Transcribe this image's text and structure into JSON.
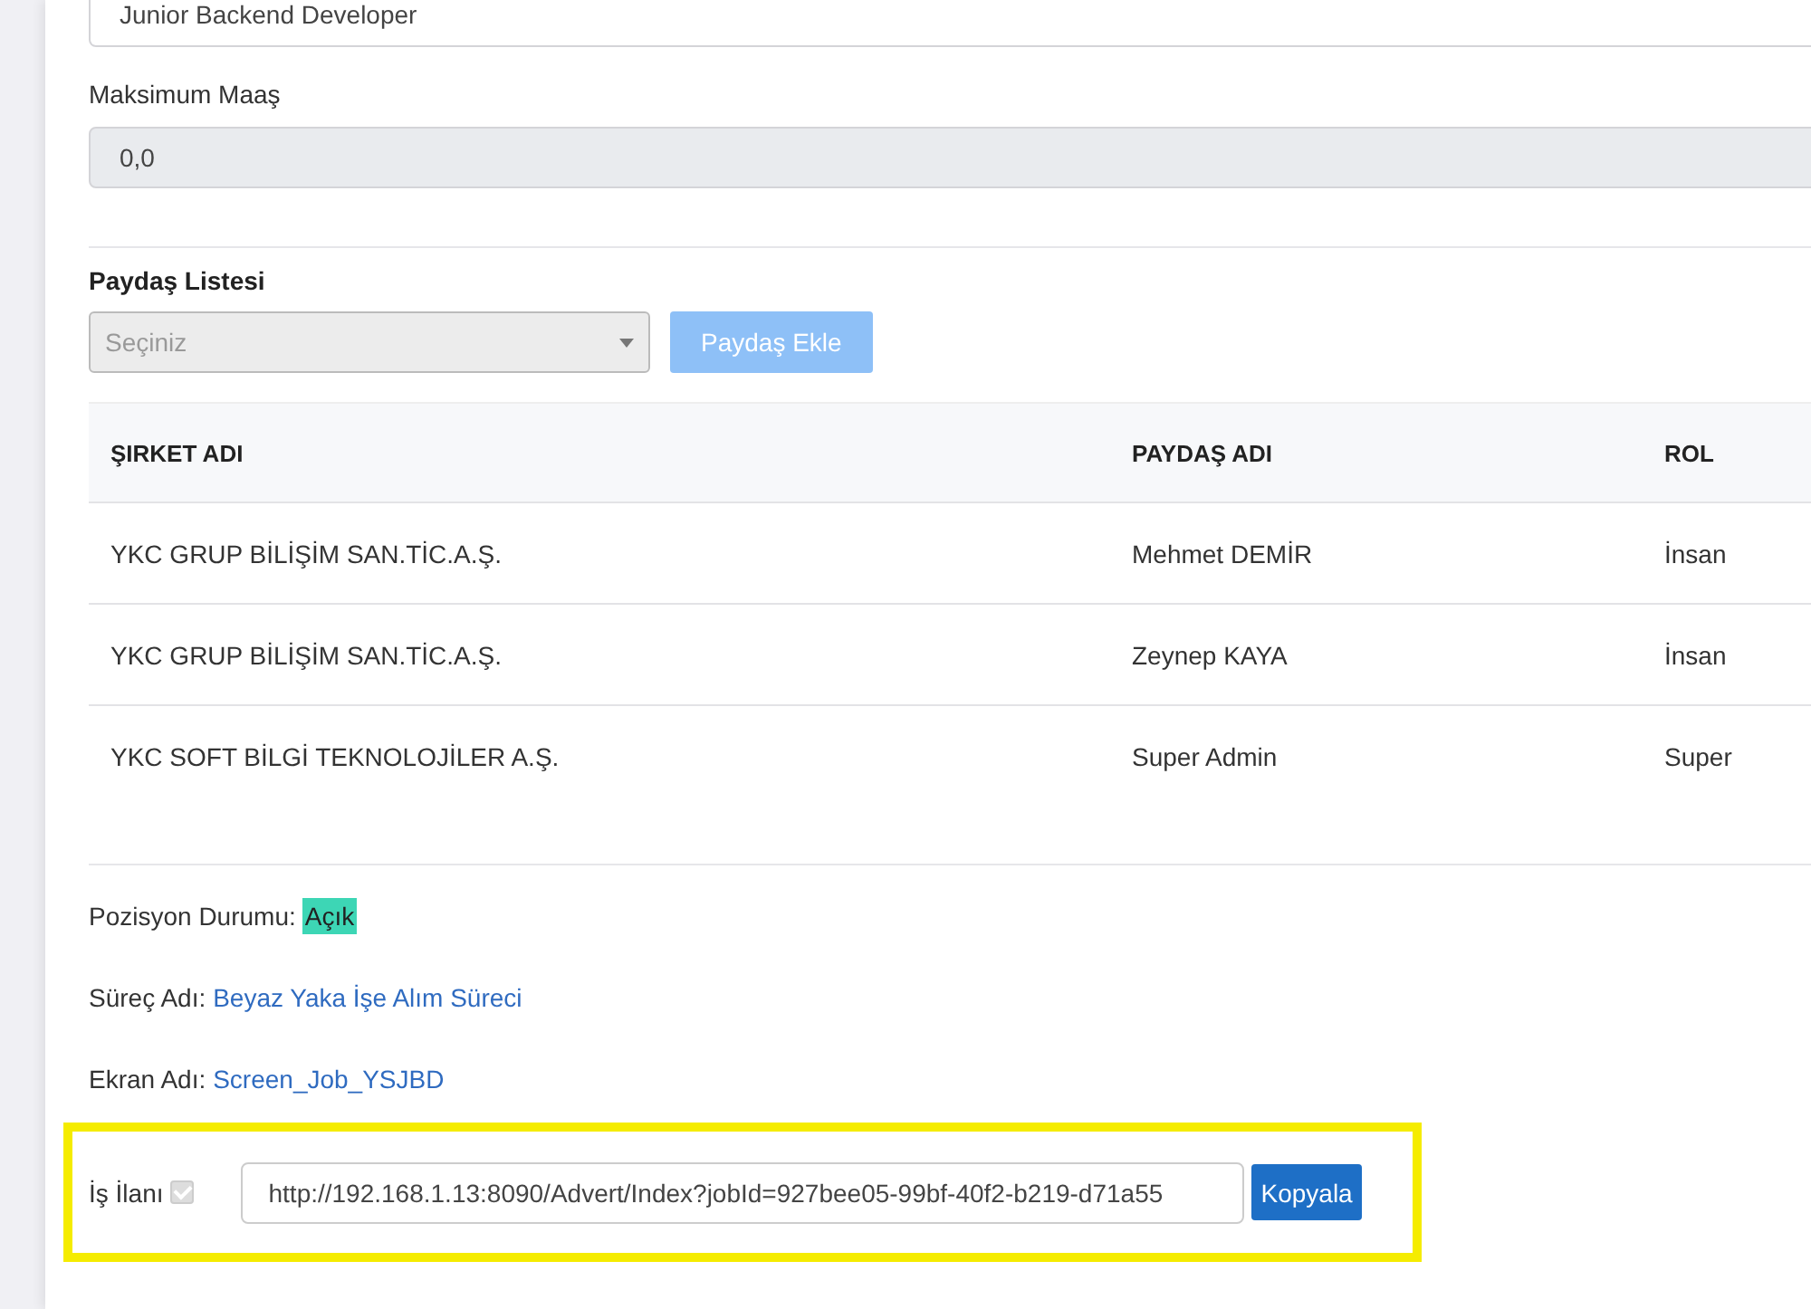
{
  "title_field": {
    "value": "Junior Backend Developer"
  },
  "max_salary": {
    "label": "Maksimum Maaş",
    "value": "0,0",
    "disabled": true
  },
  "stakeholders": {
    "title": "Paydaş Listesi",
    "select": {
      "placeholder": "Seçiniz",
      "disabled": true
    },
    "add_button": {
      "label": "Paydaş Ekle",
      "disabled": true
    },
    "table": {
      "columns": [
        "ŞIRKET ADI",
        "PAYDAŞ ADI",
        "ROL"
      ],
      "rows": [
        [
          "YKC GRUP BİLİŞİM SAN.TİC.A.Ş.",
          "Mehmet DEMİR",
          "İnsan"
        ],
        [
          "YKC GRUP BİLİŞİM SAN.TİC.A.Ş.",
          "Zeynep KAYA",
          "İnsan"
        ],
        [
          "YKC SOFT BİLGİ TEKNOLOJİLER A.Ş.",
          "Super Admin",
          "Super"
        ]
      ]
    }
  },
  "details": [
    {
      "kind": "badge",
      "label": "Pozisyon Durumu:",
      "value": "Açık"
    },
    {
      "kind": "link",
      "label": "Süreç Adı:",
      "value": "Beyaz Yaka İşe Alım Süreci"
    },
    {
      "kind": "link",
      "label": "Ekran Adı:",
      "value": "Screen_Job_YSJBD"
    }
  ],
  "job_ad": {
    "label": "İş İlanı",
    "checked": true,
    "disabled": true,
    "url": "http://192.168.1.13:8090/Advert/Index?jobId=927bee05-99bf-40f2-b219-d71a55",
    "copy_button": "Kopyala"
  }
}
